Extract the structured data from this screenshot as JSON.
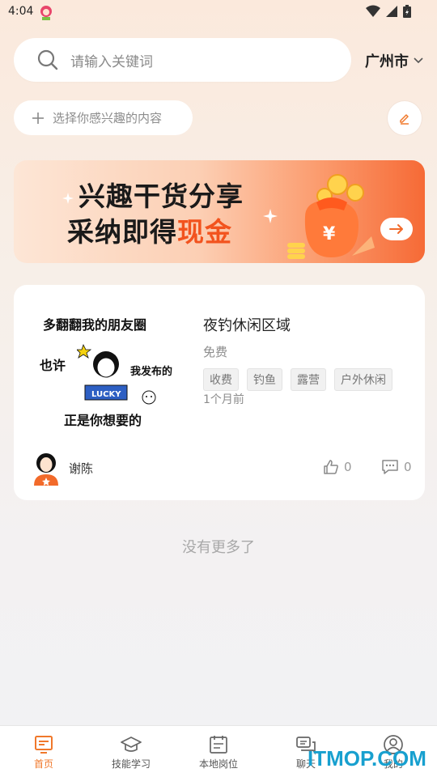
{
  "status_bar": {
    "time": "4:04"
  },
  "search": {
    "placeholder": "请输入关键词"
  },
  "location": {
    "city": "广州市"
  },
  "interest": {
    "label": "选择你感兴趣的内容"
  },
  "banner": {
    "line1": "兴趣干货分享",
    "line2_prefix": "采纳即得",
    "line2_accent": "现金"
  },
  "post": {
    "thumb": {
      "line1": "多翻翻我的朋友圈",
      "line2": "也许",
      "line3": "我发布的",
      "line4": "正是你想要的",
      "badge": "LUCKY"
    },
    "title": "夜钓休闲区域",
    "price": "免费",
    "tags": [
      "收费",
      "钓鱼",
      "露营",
      "户外休闲"
    ],
    "time": "1个月前",
    "author": "谢陈",
    "likes": "0",
    "comments": "0"
  },
  "footer_text": "没有更多了",
  "tabs": [
    {
      "label": "首页",
      "icon": "home-icon",
      "active": true
    },
    {
      "label": "技能学习",
      "icon": "graduation-cap-icon"
    },
    {
      "label": "本地岗位",
      "icon": "calendar-icon"
    },
    {
      "label": "聊天",
      "icon": "chat-icon"
    },
    {
      "label": "我的",
      "icon": "user-icon"
    }
  ],
  "watermark": "ITMOP.COM",
  "colors": {
    "accent": "#f0782b",
    "banner_accent": "#f2531e"
  }
}
